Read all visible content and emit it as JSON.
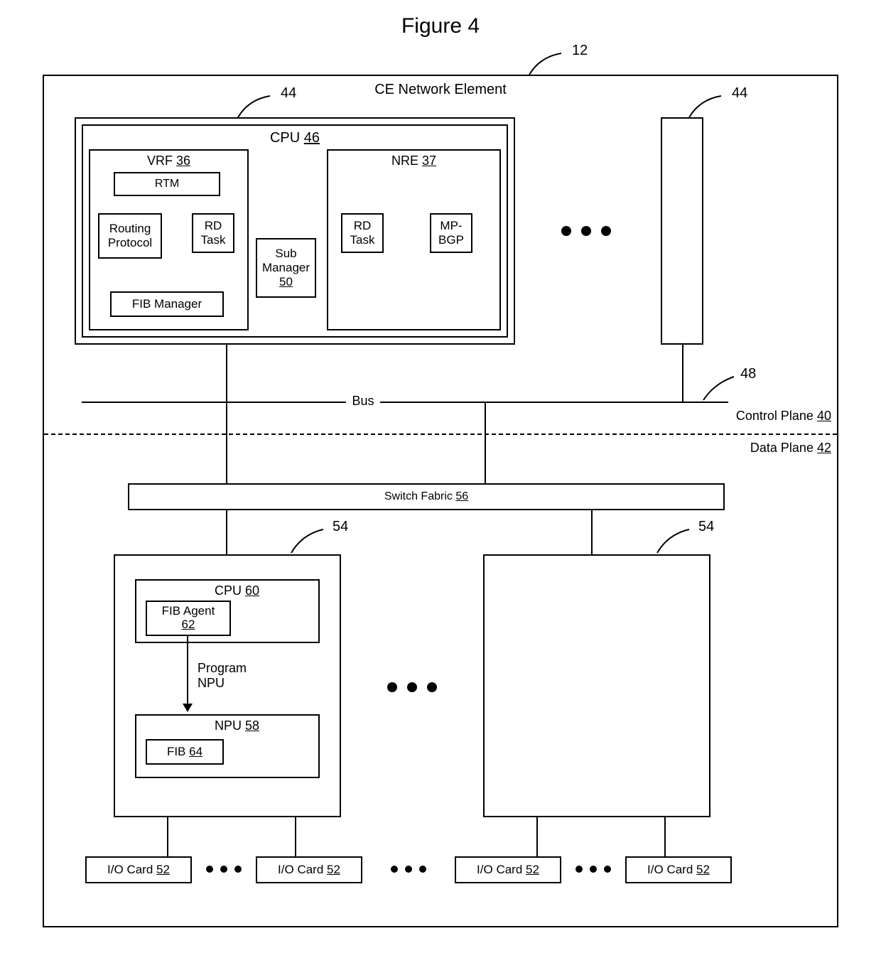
{
  "figure_title": "Figure 4",
  "outer": {
    "title": "CE Network Element",
    "ref": "12"
  },
  "card44_ref": "44",
  "cpu46": {
    "label": "CPU",
    "ref": "46"
  },
  "vrf": {
    "label": "VRF",
    "ref": "36"
  },
  "rtm": "RTM",
  "routing_protocol": "Routing Protocol",
  "rd_task": "RD Task",
  "fib_manager": "FIB Manager",
  "sub_manager": {
    "label": "Sub Manager",
    "ref": "50"
  },
  "nre": {
    "label": "NRE",
    "ref": "37"
  },
  "mp_bgp": "MP-BGP",
  "bus": {
    "label": "Bus",
    "ref": "48"
  },
  "control_plane": {
    "label": "Control Plane",
    "ref": "40"
  },
  "data_plane": {
    "label": "Data Plane",
    "ref": "42"
  },
  "switch_fabric": {
    "label": "Switch Fabric",
    "ref": "56"
  },
  "card54_ref": "54",
  "cpu60": {
    "label": "CPU",
    "ref": "60"
  },
  "fib_agent": {
    "label": "FIB Agent",
    "ref": "62"
  },
  "program_npu": "Program NPU",
  "npu": {
    "label": "NPU",
    "ref": "58"
  },
  "fib": {
    "label": "FIB",
    "ref": "64"
  },
  "io_card": {
    "label": "I/O Card",
    "ref": "52"
  }
}
